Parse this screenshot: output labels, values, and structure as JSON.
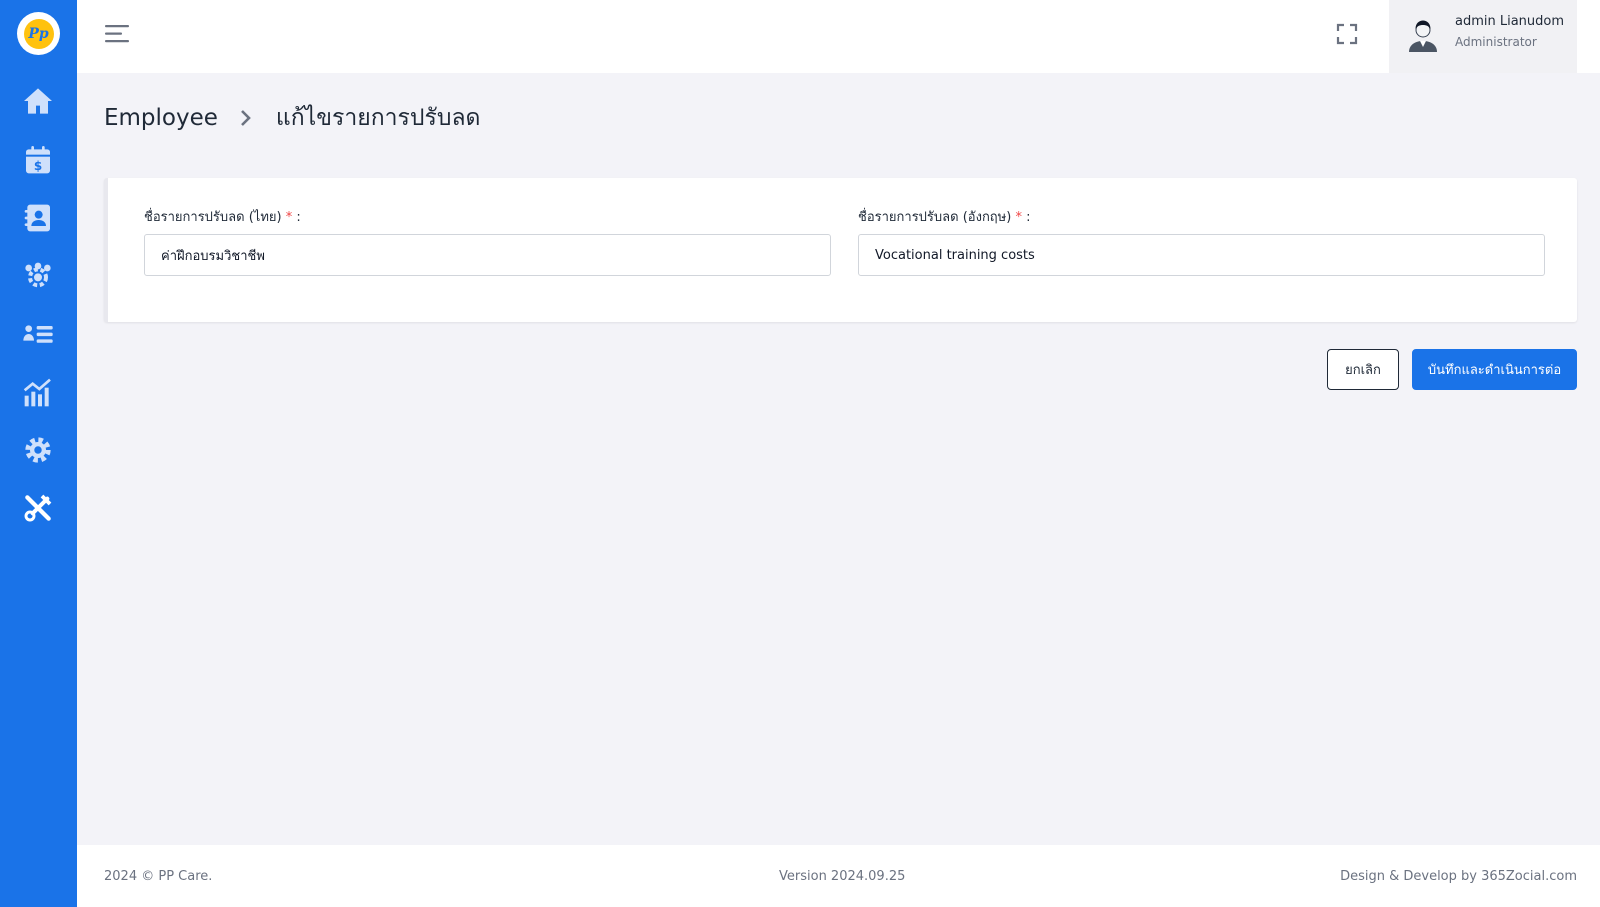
{
  "sidebar": {
    "logo_text": "Pp",
    "items": [
      {
        "icon": "home-icon"
      },
      {
        "icon": "calendar-dollar-icon"
      },
      {
        "icon": "contact-book-icon"
      },
      {
        "icon": "users-gear-icon"
      },
      {
        "icon": "user-list-icon"
      },
      {
        "icon": "chart-icon"
      },
      {
        "icon": "gear-icon"
      },
      {
        "icon": "tools-icon"
      }
    ]
  },
  "header": {
    "user_name": "admin Lianudom",
    "user_role": "Administrator"
  },
  "breadcrumb": {
    "root": "Employee",
    "current": "แก้ไขรายการปรับลด"
  },
  "form": {
    "thai_name": {
      "label": "ชื่อรายการปรับลด (ไทย)",
      "required_mark": "*",
      "suffix": " :",
      "value": "ค่าฝึกอบรมวิชาชีพ"
    },
    "english_name": {
      "label": "ชื่อรายการปรับลด (อังกฤษ)",
      "required_mark": "*",
      "suffix": " :",
      "value": "Vocational training costs"
    }
  },
  "actions": {
    "cancel_label": "ยกเลิก",
    "save_label": "บันทึกและดำเนินการต่อ"
  },
  "footer": {
    "copyright": "2024 © PP Care.",
    "version": "Version 2024.09.25",
    "credit": "Design & Develop by 365Zocial.com"
  },
  "colors": {
    "primary": "#1a73e8",
    "required": "#ef4444",
    "background": "#f3f3f8"
  }
}
